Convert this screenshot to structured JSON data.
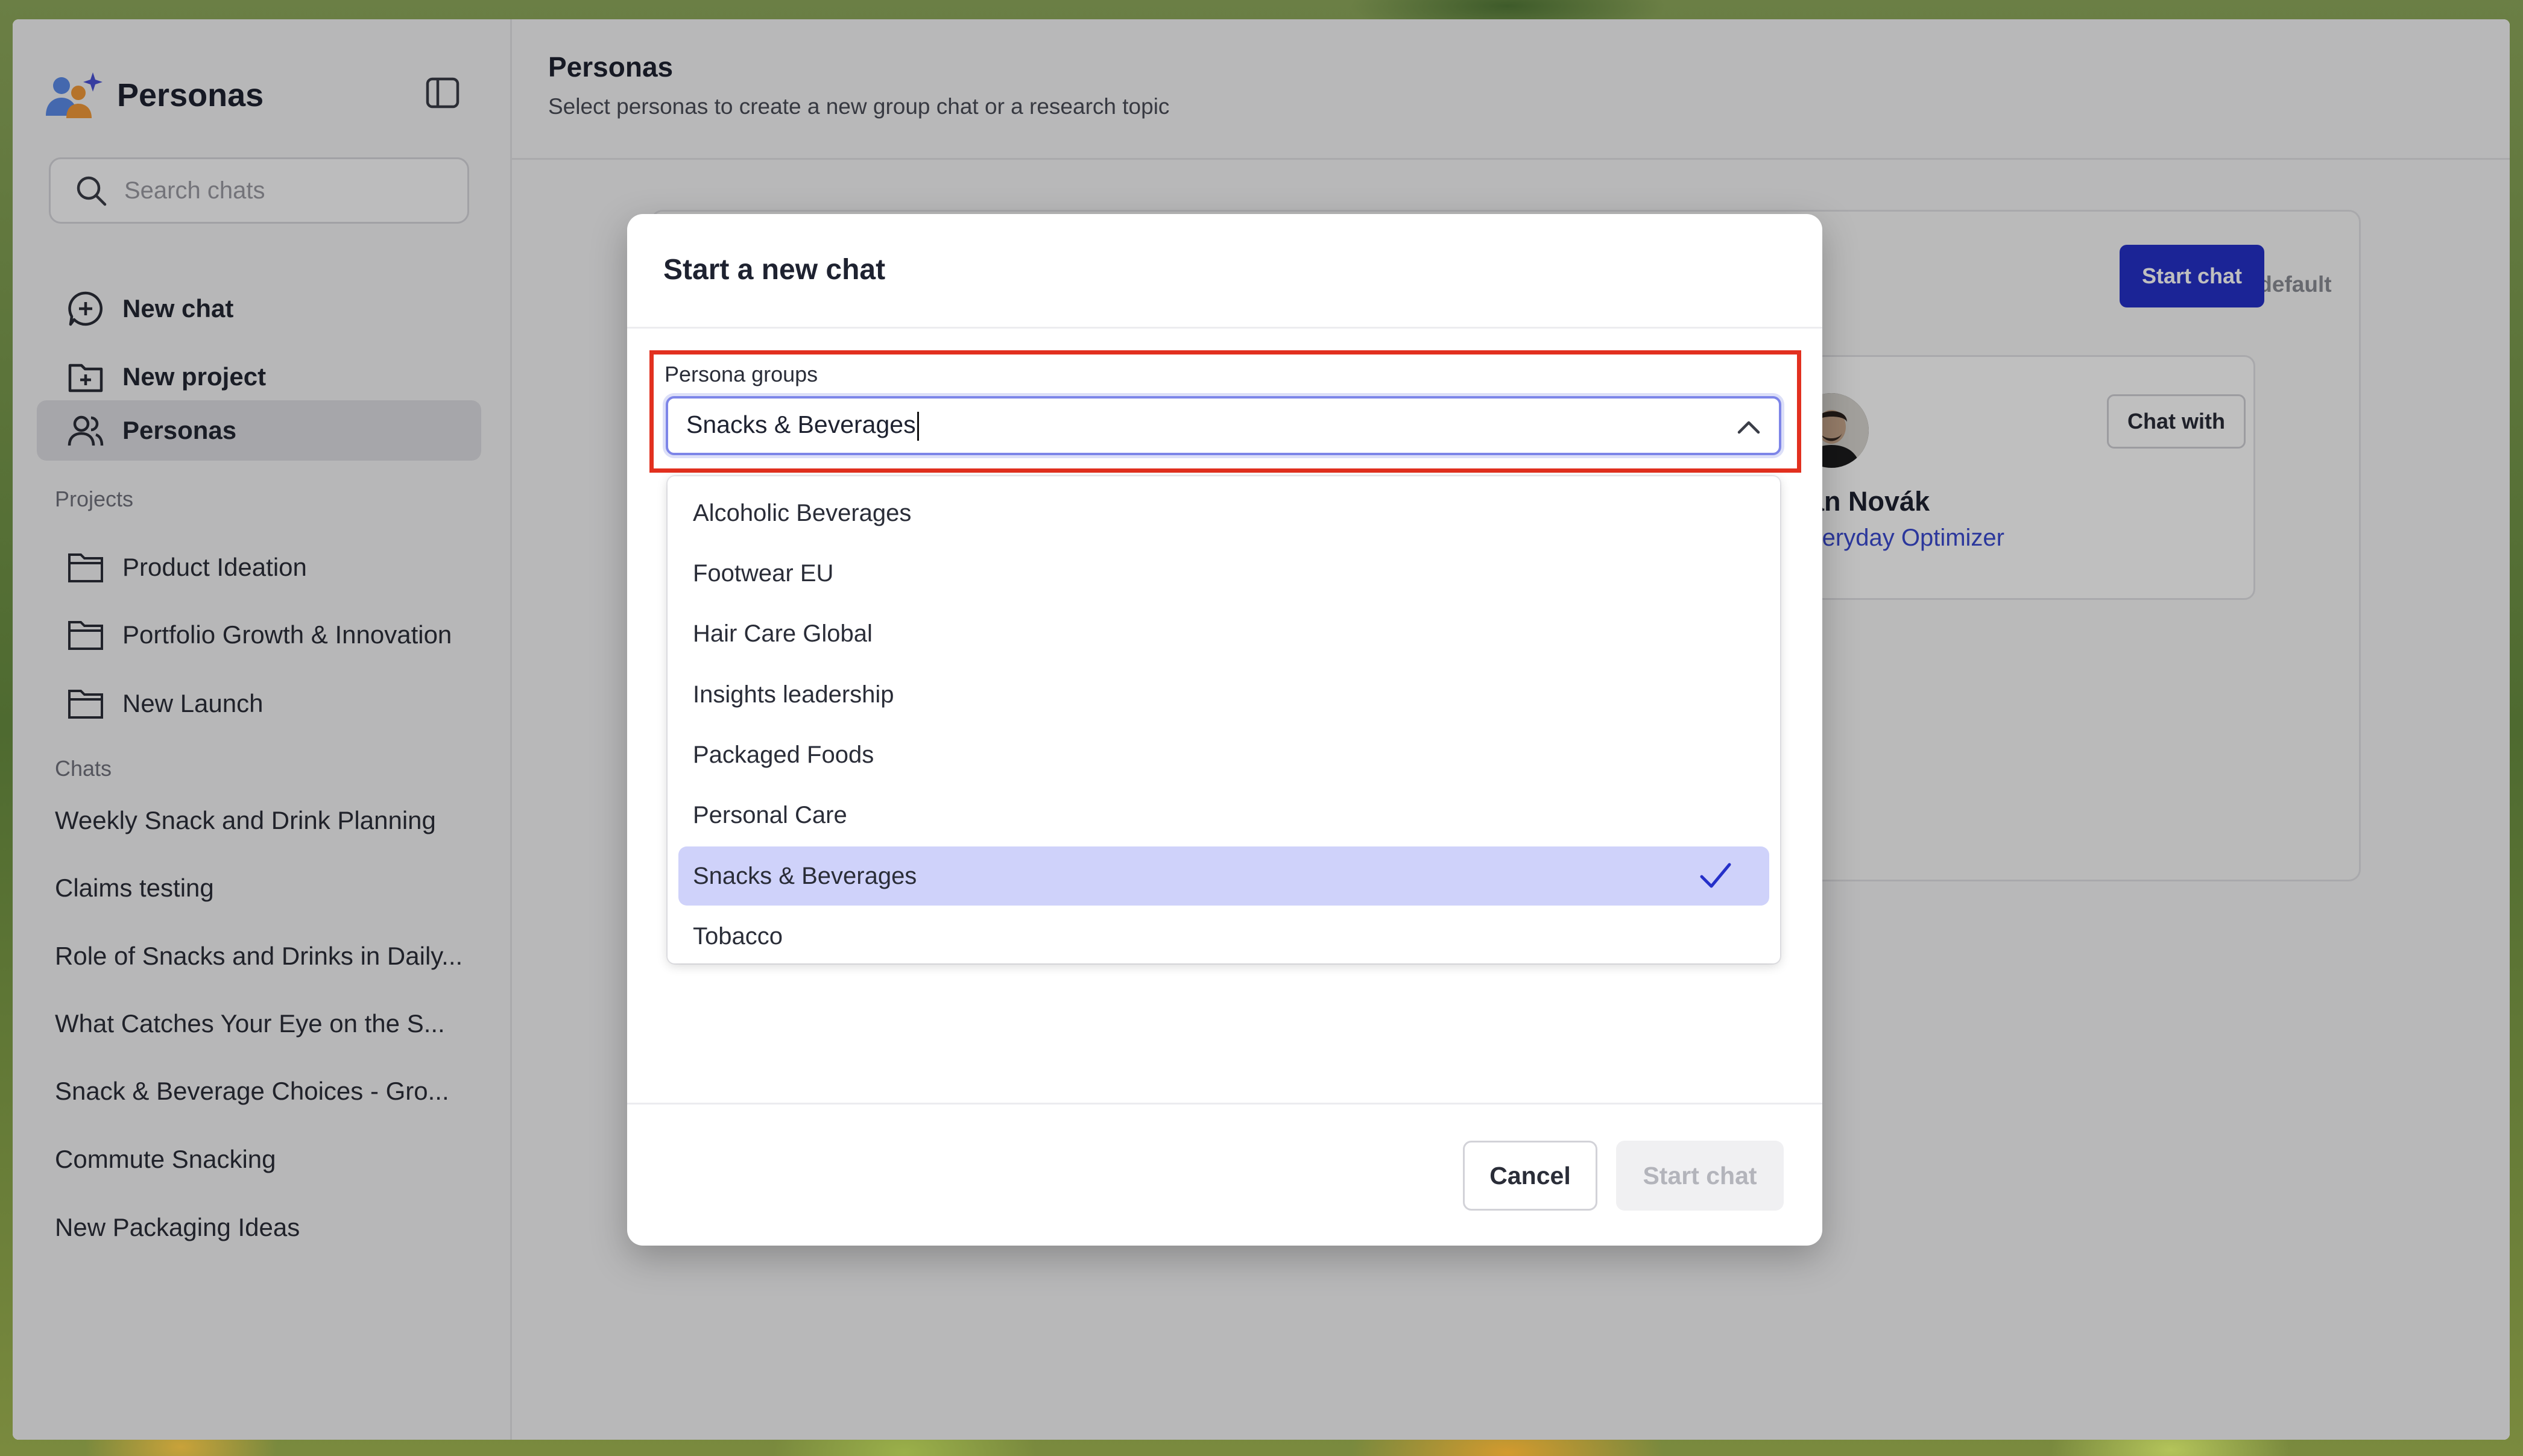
{
  "sidebar": {
    "app_title": "Personas",
    "search_placeholder": "Search chats",
    "nav": [
      {
        "label": "New chat",
        "icon": "chat-plus-icon"
      },
      {
        "label": "New project",
        "icon": "folder-plus-icon"
      },
      {
        "label": "Personas",
        "icon": "users-icon",
        "active": true
      }
    ],
    "projects_label": "Projects",
    "projects": [
      "Product Ideation",
      "Portfolio Growth & Innovation",
      "New Launch"
    ],
    "chats_label": "Chats",
    "chats": [
      "Weekly Snack and Drink Planning",
      "Claims testing",
      "Role of Snacks and Drinks in Daily...",
      "What Catches Your Eye on the S...",
      "Snack & Beverage Choices - Gro...",
      "Commute Snacking",
      "New Packaging Ideas"
    ]
  },
  "main": {
    "title": "Personas",
    "subtitle": "Select personas to create a new group chat or a research topic",
    "set_default_label": "Set as default",
    "start_chat_label": "Start chat",
    "persona": {
      "name": "Jan Novák",
      "role": "Everyday Optimizer",
      "chat_with_label": "Chat with"
    }
  },
  "modal": {
    "title": "Start a new chat",
    "field_label": "Persona groups",
    "selected_value": "Snacks & Beverages",
    "options": [
      "Alcoholic Beverages",
      "Footwear EU",
      "Hair Care Global",
      "Insights leadership",
      "Packaged Foods",
      "Personal Care",
      "Snacks & Beverages",
      "Tobacco"
    ],
    "selected_index": 6,
    "cancel_label": "Cancel",
    "start_label": "Start chat"
  },
  "colors": {
    "accent": "#2530c9",
    "highlight_border": "#e2301f",
    "selected_option": "#cfd2fa",
    "persona_role": "#3a4ad0"
  }
}
